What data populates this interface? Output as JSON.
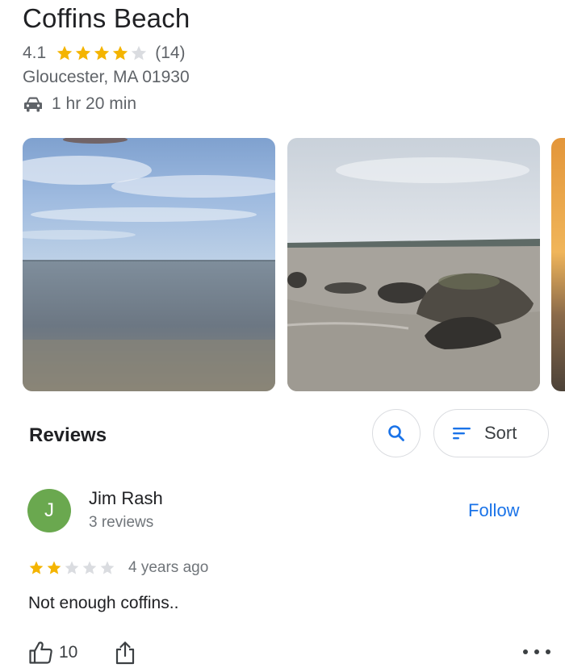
{
  "place": {
    "name": "Coffins Beach",
    "rating": "4.1",
    "rating_value": 4.1,
    "review_count": "(14)",
    "address": "Gloucester, MA 01930",
    "drive_time": "1 hr 20 min"
  },
  "icons": {
    "car": "car-icon",
    "search": "search-icon",
    "sort": "sort-icon",
    "like": "thumb-up-icon",
    "share": "share-icon",
    "more": "more-horizontal-icon",
    "star": "star-icon"
  },
  "reviews": {
    "heading": "Reviews",
    "sort_label": "Sort",
    "items": [
      {
        "avatar_letter": "J",
        "name": "Jim Rash",
        "reviewer_count": "3 reviews",
        "follow_label": "Follow",
        "stars": 2,
        "date": "4 years ago",
        "text": "Not enough coffins..",
        "likes": "10"
      }
    ]
  },
  "colors": {
    "star_filled": "#f4b400",
    "star_empty": "#dadce0",
    "accent": "#1a73e8",
    "avatar": "#6aa84f"
  }
}
